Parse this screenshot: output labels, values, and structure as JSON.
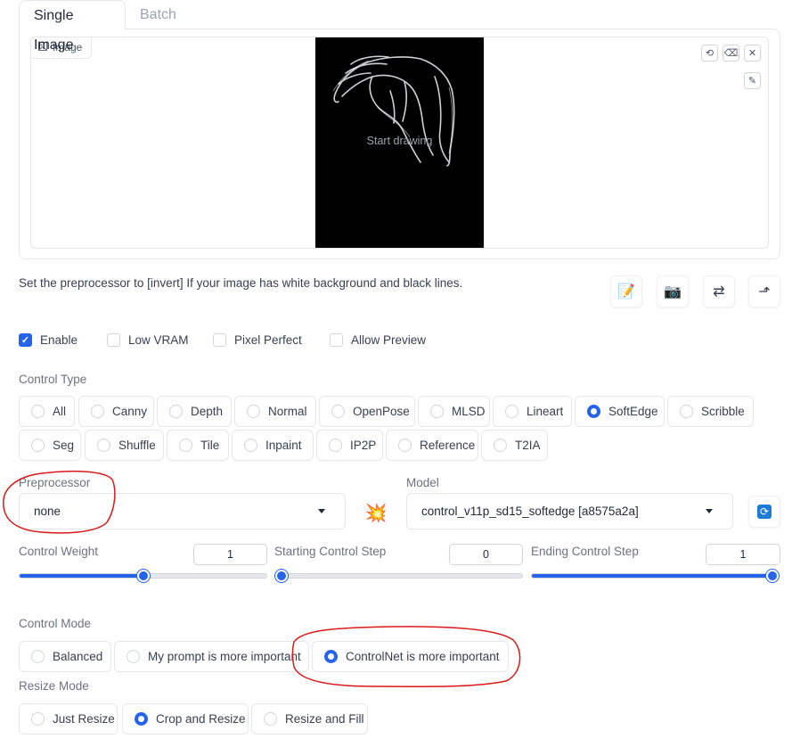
{
  "tabs": {
    "single_image": "Single Image",
    "batch": "Batch"
  },
  "image_panel": {
    "label": "Image",
    "canvas_placeholder": "Start drawing"
  },
  "hint_text": "Set the preprocessor to [invert] If your image has white background and black lines.",
  "checkboxes": [
    {
      "label": "Enable",
      "checked": true
    },
    {
      "label": "Low VRAM",
      "checked": false
    },
    {
      "label": "Pixel Perfect",
      "checked": false
    },
    {
      "label": "Allow Preview",
      "checked": false
    }
  ],
  "control_type": {
    "label": "Control Type",
    "options": [
      "All",
      "Canny",
      "Depth",
      "Normal",
      "OpenPose",
      "MLSD",
      "Lineart",
      "SoftEdge",
      "Scribble",
      "Seg",
      "Shuffle",
      "Tile",
      "Inpaint",
      "IP2P",
      "Reference",
      "T2IA"
    ],
    "selected": "SoftEdge"
  },
  "preprocessor": {
    "label": "Preprocessor",
    "value": "none"
  },
  "model": {
    "label": "Model",
    "value": "control_v11p_sd15_softedge [a8575a2a]"
  },
  "sliders": {
    "control_weight": {
      "label": "Control Weight",
      "value": "1",
      "fraction": 0.5
    },
    "starting_step": {
      "label": "Starting Control Step",
      "value": "0",
      "fraction": 0.0
    },
    "ending_step": {
      "label": "Ending Control Step",
      "value": "1",
      "fraction": 1.0
    }
  },
  "control_mode": {
    "label": "Control Mode",
    "options": [
      "Balanced",
      "My prompt is more important",
      "ControlNet is more important"
    ],
    "selected": "ControlNet is more important"
  },
  "resize_mode": {
    "label": "Resize Mode",
    "options": [
      "Just Resize",
      "Crop and Resize",
      "Resize and Fill"
    ],
    "selected": "Crop and Resize"
  },
  "colors": {
    "accent": "#2563eb",
    "annotation": "#d91a1a"
  },
  "icons": [
    "image-icon",
    "undo-icon",
    "eraser-icon",
    "close-icon",
    "brush-icon",
    "notepad-icon",
    "camera-icon",
    "swap-icon",
    "send-icon",
    "explosion-icon",
    "refresh-icon"
  ]
}
